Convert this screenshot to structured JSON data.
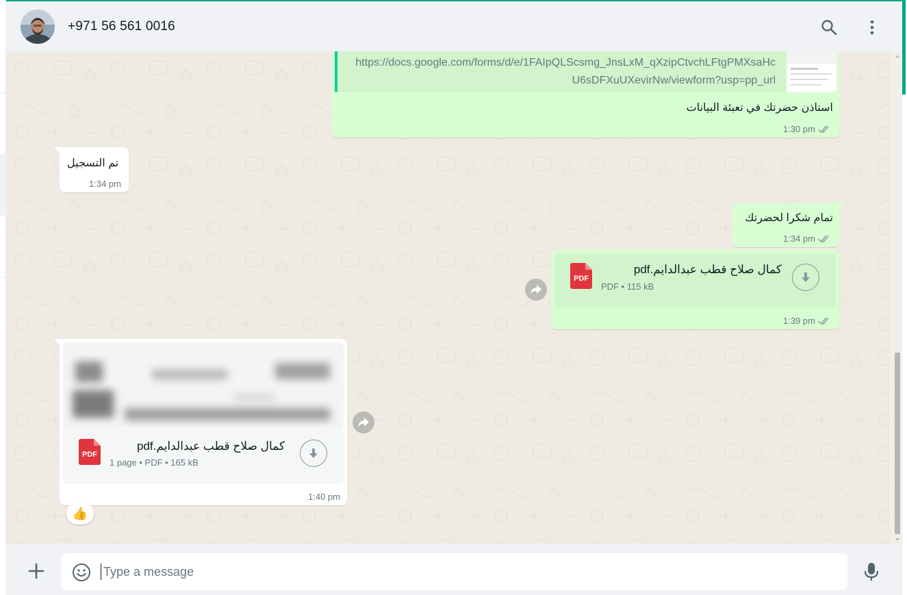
{
  "header": {
    "contact_name": "+971 56 561 0016",
    "icons": [
      "avatar",
      "search-icon",
      "menu-icon"
    ]
  },
  "messages": {
    "link_message": {
      "url_line1": "https://docs.google.com/forms/d/e/1FAIpQLScsmg_JnsLxM_qXzipCtvchLFtgPMXsaHc",
      "url_line2": "U6sDFXuUXevirNw/viewform?usp=pp_url",
      "text": "استاذن حضرتك في تعبئة البيانات",
      "time": "1:30 pm"
    },
    "incoming_1": {
      "text": "تم التسجيل",
      "time": "1:34 pm"
    },
    "outgoing_2": {
      "text": "تمام شكرا لحضرتك",
      "time": "1:34 pm"
    },
    "outgoing_doc": {
      "icon_label": "PDF",
      "file_name": "كمال صلاح قطب عبدالدايم.pdf",
      "file_meta": "PDF • 115 kB",
      "time": "1:39 pm"
    },
    "incoming_doc": {
      "icon_label": "PDF",
      "file_name": "كمال صلاح قطب عبدالدايم.pdf",
      "file_meta": "1 page • PDF • 165 kB",
      "time": "1:40 pm",
      "reaction": "👍"
    }
  },
  "composer": {
    "placeholder": "Type a message",
    "value": ""
  },
  "colors": {
    "accent": "#00a884",
    "outgoing_bubble": "#d9fdd3",
    "incoming_bubble": "#ffffff",
    "chat_background": "#efeae2",
    "header_background": "#f0f2f5",
    "pdf_red": "#e0353d"
  }
}
